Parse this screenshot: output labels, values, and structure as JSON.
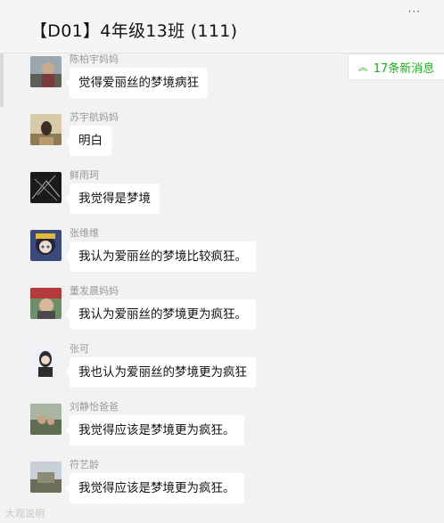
{
  "header": {
    "title": "【D01】4年级13班 (111)",
    "more": "···"
  },
  "new_messages": {
    "label": "17条新消息"
  },
  "messages": [
    {
      "name": "陈柏宇妈妈",
      "text": "觉得爱丽丝的梦境病狂"
    },
    {
      "name": "苏宇航妈妈",
      "text": "明白"
    },
    {
      "name": "鲜雨珂",
      "text": "我觉得是梦境"
    },
    {
      "name": "张维维",
      "text": "我认为爱丽丝的梦境比较疯狂。"
    },
    {
      "name": "董发晨妈妈",
      "text": "我认为爱丽丝的梦境更为疯狂。"
    },
    {
      "name": "张可",
      "text": "我也认为爱丽丝的梦境更为疯狂"
    },
    {
      "name": "刘静怡爸爸",
      "text": "我觉得应该是梦境更为疯狂。"
    },
    {
      "name": "符艺龄",
      "text": "我觉得应该是梦境更为疯狂。"
    }
  ],
  "watermark": "大观说明"
}
